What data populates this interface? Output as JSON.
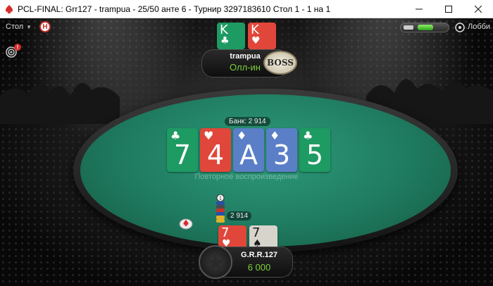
{
  "window": {
    "title": "PCL-FINAL: Grr127 - trampua - 25/50 анте 6 - Турнир 3297183610 Стол 1 - 1 на 1",
    "buttons": [
      "minimize",
      "maximize",
      "close"
    ]
  },
  "toolbar": {
    "table_menu": "Стол",
    "hotkey_badge": "H",
    "notification_count": "!",
    "lobby_label": "Лобби"
  },
  "table": {
    "pot_label": "Банк: 2 914",
    "felt_text": "Повторное воспроизведение",
    "board": [
      {
        "rank": "7",
        "suit": "♣",
        "color": "green"
      },
      {
        "rank": "4",
        "suit": "♥",
        "color": "red"
      },
      {
        "rank": "A",
        "suit": "♦",
        "color": "blue"
      },
      {
        "rank": "3",
        "suit": "♦",
        "color": "blue"
      },
      {
        "rank": "5",
        "suit": "♣",
        "color": "green"
      }
    ],
    "bet_amount": "2 914",
    "chip_stack_marker": "1"
  },
  "players": {
    "top": {
      "name": "trampua",
      "status": "Олл-ин",
      "badge": "BOSS",
      "cards": [
        {
          "rank": "K",
          "suit": "♣",
          "color": "green"
        },
        {
          "rank": "K",
          "suit": "♥",
          "color": "red"
        }
      ]
    },
    "bottom": {
      "name": "G.R.R.127",
      "stack": "6 000",
      "cards": [
        {
          "rank": "7",
          "suit": "♥",
          "color": "red"
        },
        {
          "rank": "7",
          "suit": "♠",
          "color": "grey"
        }
      ]
    }
  },
  "colors": {
    "felt": "#1f7b60",
    "card_green": "#1e9a63",
    "card_red": "#e0473a",
    "card_blue": "#5a7fc7",
    "status_green": "#7cd23a",
    "brand_red": "#c8312b"
  }
}
